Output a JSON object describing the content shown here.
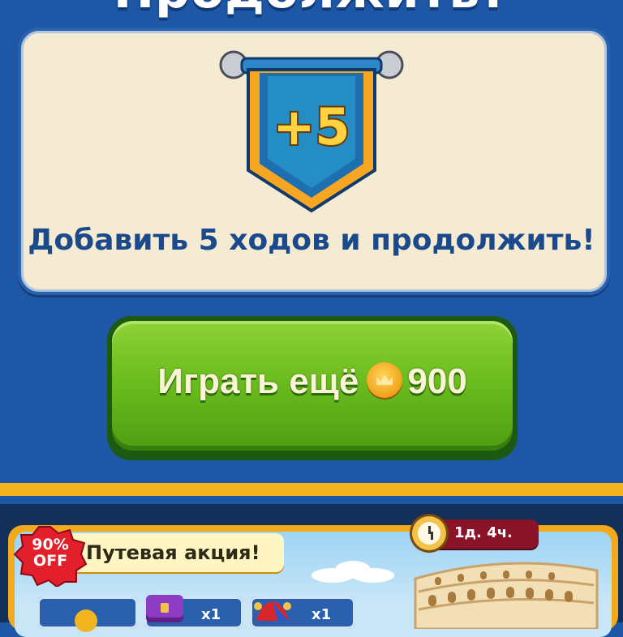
{
  "header": {
    "title": "Продолжить?"
  },
  "panel": {
    "badge_text": "+5",
    "message": "Добавить 5 ходов и продолжить!"
  },
  "play_button": {
    "label": "Играть ещё",
    "price": "900",
    "icon": "coin-icon"
  },
  "offer": {
    "discount": "90% OFF",
    "title": "Путевая акция!",
    "timer": "1д. 4ч.",
    "items": [
      {
        "icon": "coin-stack-icon"
      },
      {
        "icon": "chest-icon",
        "count": "x1"
      },
      {
        "icon": "jester-hat-icon",
        "count": "x1"
      }
    ]
  },
  "colors": {
    "background": "#1d57a6",
    "panel": "#f5ead2",
    "button": "#6cbd1f",
    "accent": "#f1b41d"
  }
}
